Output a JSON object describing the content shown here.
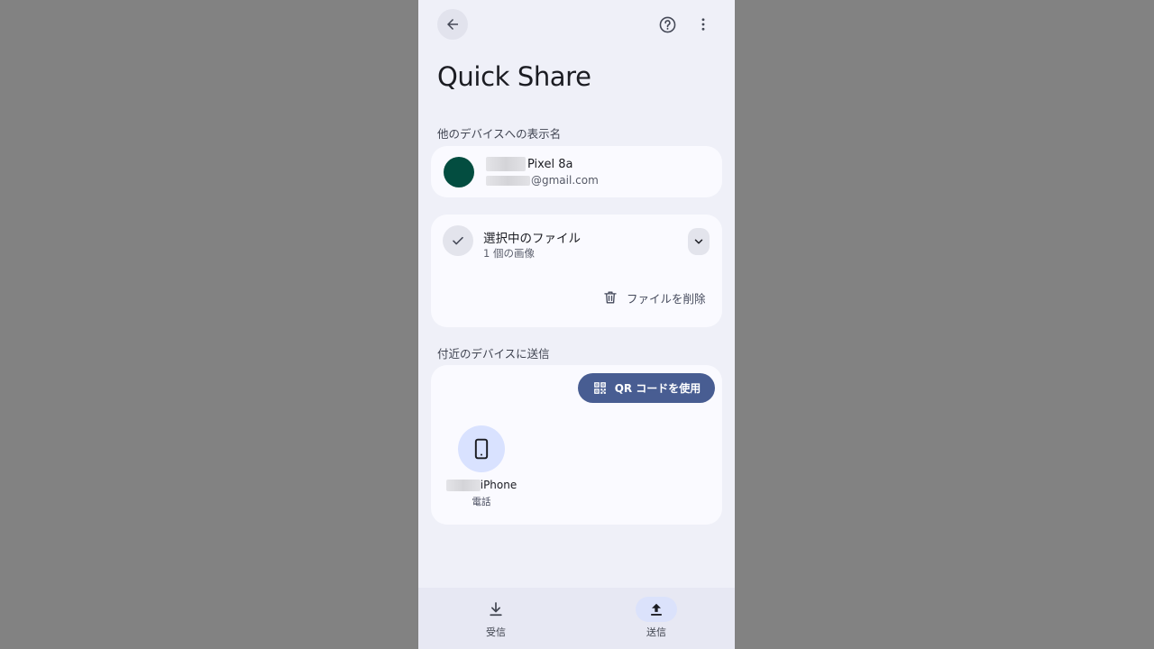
{
  "colors": {
    "page_background": "#828282",
    "screen_background": "#eff0f8",
    "card_background": "#fafaff",
    "avatar": "#034d40",
    "primary_button": "#485d92",
    "device_circle": "#d9e2ff",
    "nav_background": "#e7e8f3",
    "nav_active_pill": "#dbe2fb"
  },
  "top_bar": {
    "back_icon": "arrow-back-icon",
    "help_icon": "help-circle-icon",
    "more_icon": "more-vert-icon"
  },
  "title": "Quick Share",
  "display_name_section": {
    "label": "他のデバイスへの表示名",
    "device_name": "Pixel 8a",
    "email": "@gmail.com"
  },
  "files_section": {
    "title": "選択中のファイル",
    "subtitle": "1 個の画像",
    "check_icon": "check-icon",
    "expand_icon": "chevron-down-icon",
    "delete_icon": "trash-icon",
    "delete_label": "ファイルを削除"
  },
  "nearby_section": {
    "label": "付近のデバイスに送信",
    "qr_icon": "qr-code-icon",
    "qr_button_label": "QR コードを使用",
    "devices": [
      {
        "name": "iPhone",
        "type": "電話",
        "icon": "smartphone-icon"
      }
    ]
  },
  "bottom_nav": {
    "items": [
      {
        "label": "受信",
        "icon": "download-icon",
        "active": false
      },
      {
        "label": "送信",
        "icon": "upload-icon",
        "active": true
      }
    ]
  }
}
